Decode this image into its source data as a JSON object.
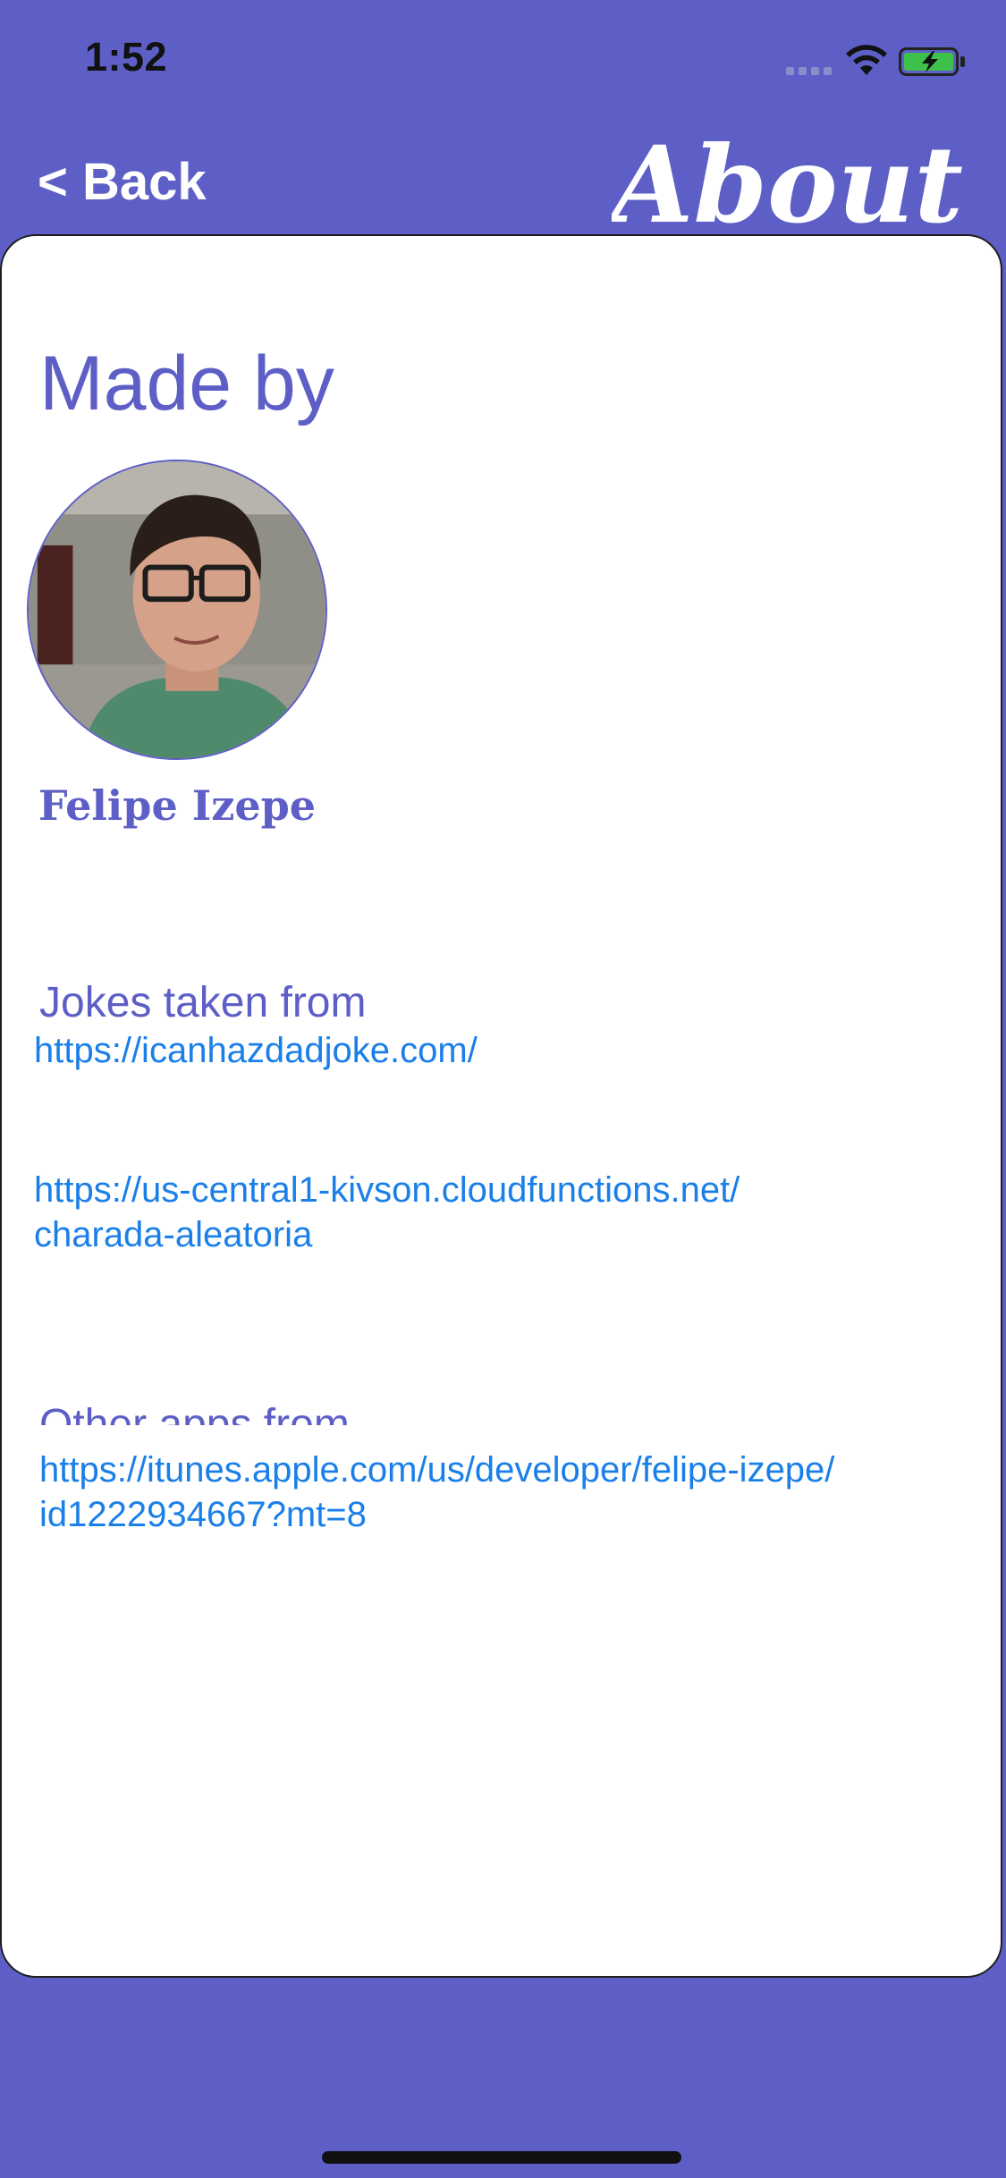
{
  "status_bar": {
    "time": "1:52",
    "icons": [
      "signal-icon",
      "wifi-icon",
      "battery-charging-icon"
    ]
  },
  "nav": {
    "back_label": "< Back",
    "title": "About"
  },
  "made_by": {
    "heading": "Made by",
    "avatar": "author-photo",
    "author_name": "Felipe Izepe"
  },
  "jokes": {
    "heading": "Jokes taken from",
    "links": [
      {
        "line1": "https://icanhazdadjoke.com/",
        "line2": ""
      },
      {
        "line1": "https://us-central1-kivson.cloudfunctions.net/",
        "line2": "charada-aleatoria"
      }
    ]
  },
  "other_apps": {
    "heading": "Other apps from",
    "link": {
      "line1": "https://itunes.apple.com/us/developer/felipe-izepe/",
      "line2": "id1222934667?mt=8"
    }
  },
  "colors": {
    "background": "#5d5fc6",
    "accent": "#5d5fc6",
    "link": "#1a7fe8",
    "card": "#ffffff"
  }
}
